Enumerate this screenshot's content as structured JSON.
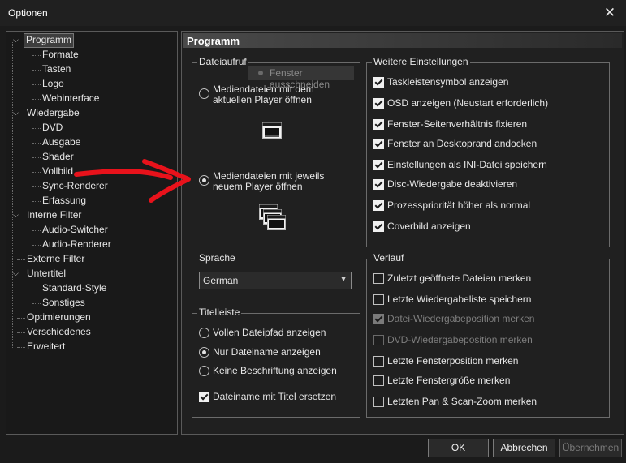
{
  "window": {
    "title": "Optionen",
    "close_label": "✕"
  },
  "tree": {
    "items": [
      {
        "label": "Programm",
        "level": 0,
        "expanded": true,
        "selected": true
      },
      {
        "label": "Formate",
        "level": 1
      },
      {
        "label": "Tasten",
        "level": 1
      },
      {
        "label": "Logo",
        "level": 1
      },
      {
        "label": "Webinterface",
        "level": 1
      },
      {
        "label": "Wiedergabe",
        "level": 0,
        "expanded": true
      },
      {
        "label": "DVD",
        "level": 1
      },
      {
        "label": "Ausgabe",
        "level": 1
      },
      {
        "label": "Shader",
        "level": 1
      },
      {
        "label": "Vollbild",
        "level": 1
      },
      {
        "label": "Sync-Renderer",
        "level": 1
      },
      {
        "label": "Erfassung",
        "level": 1
      },
      {
        "label": "Interne Filter",
        "level": 0,
        "expanded": true
      },
      {
        "label": "Audio-Switcher",
        "level": 1
      },
      {
        "label": "Audio-Renderer",
        "level": 1
      },
      {
        "label": "Externe Filter",
        "level": 0
      },
      {
        "label": "Untertitel",
        "level": 0,
        "expanded": true
      },
      {
        "label": "Standard-Style",
        "level": 1
      },
      {
        "label": "Sonstiges",
        "level": 1
      },
      {
        "label": "Optimierungen",
        "level": 0
      },
      {
        "label": "Verschiedenes",
        "level": 0
      },
      {
        "label": "Erweitert",
        "level": 0
      }
    ]
  },
  "panel": {
    "title": "Programm"
  },
  "tooltip_ghost": "Fenster ausschneiden",
  "dateiaufruf": {
    "label": "Dateiaufruf",
    "option1": "Mediendateien mit dem aktuellen Player öffnen",
    "option2": "Mediendateien mit jeweils neuem Player öffnen",
    "selected": 2
  },
  "sprache": {
    "label": "Sprache",
    "value": "German"
  },
  "titelleiste": {
    "label": "Titelleiste",
    "options": [
      "Vollen Dateipfad anzeigen",
      "Nur Dateiname anzeigen",
      "Keine Beschriftung anzeigen"
    ],
    "selected": 1,
    "checkbox": "Dateiname mit Titel ersetzen",
    "checkbox_checked": true
  },
  "weitere": {
    "label": "Weitere Einstellungen",
    "items": [
      {
        "label": "Taskleistensymbol anzeigen",
        "checked": true
      },
      {
        "label": "OSD anzeigen (Neustart erforderlich)",
        "checked": true
      },
      {
        "label": "Fenster-Seitenverhältnis fixieren",
        "checked": true
      },
      {
        "label": "Fenster an Desktoprand andocken",
        "checked": true
      },
      {
        "label": "Einstellungen als INI-Datei speichern",
        "checked": true
      },
      {
        "label": "Disc-Wiedergabe deaktivieren",
        "checked": true
      },
      {
        "label": "Prozesspriorität höher als normal",
        "checked": true
      },
      {
        "label": "Coverbild anzeigen",
        "checked": true
      }
    ]
  },
  "verlauf": {
    "label": "Verlauf",
    "items": [
      {
        "label": "Zuletzt geöffnete Dateien merken",
        "checked": false,
        "disabled": false
      },
      {
        "label": "Letzte Wiedergabeliste speichern",
        "checked": false,
        "disabled": false
      },
      {
        "label": "Datei-Wiedergabeposition merken",
        "checked": true,
        "disabled": true
      },
      {
        "label": "DVD-Wiedergabeposition merken",
        "checked": false,
        "disabled": true
      },
      {
        "label": "Letzte Fensterposition merken",
        "checked": false,
        "disabled": false
      },
      {
        "label": "Letzte Fenstergröße merken",
        "checked": false,
        "disabled": false
      },
      {
        "label": "Letzten Pan & Scan-Zoom merken",
        "checked": false,
        "disabled": false
      }
    ]
  },
  "buttons": {
    "ok": "OK",
    "cancel": "Abbrechen",
    "apply": "Übernehmen"
  },
  "colors": {
    "background": "#1b1b1b",
    "arrow": "#e8121b"
  }
}
